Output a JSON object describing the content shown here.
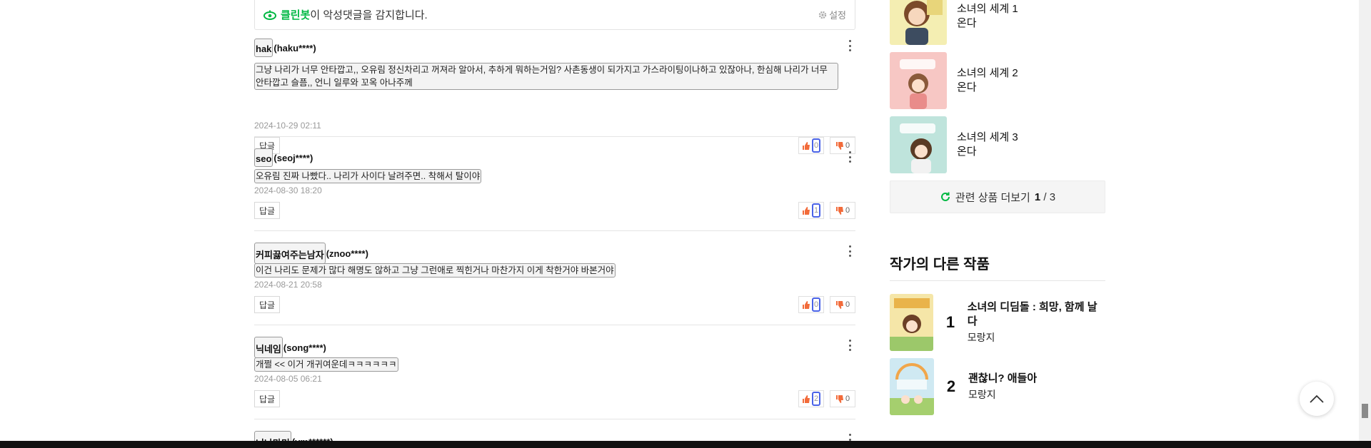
{
  "cleanbot": {
    "brand": "클린봇",
    "message": "이 악성댓글을 감지합니다.",
    "settings_label": "설정"
  },
  "comments": [
    {
      "nickname": "hak",
      "user_id": "(haku****)",
      "text": "그냥 나리가 너무 안타깝고,, 오유림 정신차리고 꺼져라 알아서, 추하게 뭐하는거임? 사촌동생이 되가지고 가스라이팅이나하고 있잖아나, 한심해 나리가 너무 안타깝고 슬픔,, 언니 일루와 꼬옥 아나주께",
      "date": "2024-10-29 02:11",
      "reply_label": "답글",
      "likes": "0",
      "dislikes": "0"
    },
    {
      "nickname": "seo",
      "user_id": "(seoj****)",
      "text": "오유림 진짜 나빴다.. 나리가 사이다 날려주면.. 착해서 탈이야",
      "date": "2024-08-30 18:20",
      "reply_label": "답글",
      "likes": "1",
      "dislikes": "0"
    },
    {
      "nickname": "커피끓여주는남자",
      "user_id": "(znoo****)",
      "text": "이건 나리도 문제가 많다 해명도 않하고 그냥 그런애로 찍힌거나 마찬가지 이게 착한거야 바본거야",
      "date": "2024-08-21 20:58",
      "reply_label": "답글",
      "likes": "0",
      "dislikes": "0"
    },
    {
      "nickname": "닉네임",
      "user_id": "(song****)",
      "text": "개쩔 << 이거 개귀여운데ㅋㅋㅋㅋㅋㅋ",
      "date": "2024-08-05 06:21",
      "reply_label": "답글",
      "likes": "2",
      "dislikes": "0"
    },
    {
      "nickname": "너나마미",
      "user_id": "(ym******)",
      "text": "",
      "date": "",
      "reply_label": "",
      "likes": "",
      "dislikes": ""
    }
  ],
  "related": {
    "items": [
      {
        "title": "소녀의 세계 1",
        "author": "온다"
      },
      {
        "title": "소녀의 세계 2",
        "author": "온다"
      },
      {
        "title": "소녀의 세계 3",
        "author": "온다"
      }
    ],
    "more_label": "관련 상품 더보기",
    "page_current": "1",
    "page_sep": " / ",
    "page_total": "3"
  },
  "author_works": {
    "title": "작가의 다른 작품",
    "items": [
      {
        "rank": "1",
        "title": "소녀의 디딤돌 : 희망, 함께 날다",
        "author": "모랑지"
      },
      {
        "rank": "2",
        "title": "괜찮니? 애들아",
        "author": "모랑지"
      }
    ]
  },
  "colors": {
    "accent_green": "#00b843",
    "vote_highlight": "#4a63e7"
  }
}
